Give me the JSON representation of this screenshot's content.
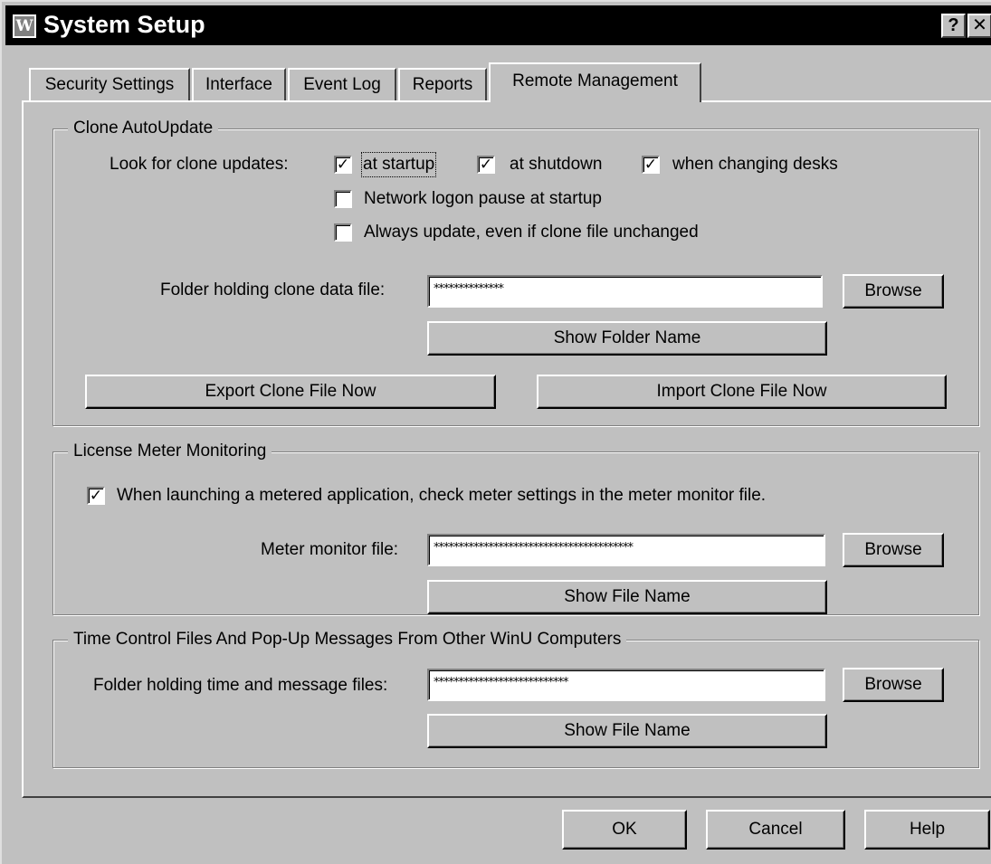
{
  "window": {
    "title": "System Setup",
    "help_glyph": "?",
    "close_glyph": "✕",
    "icon_letter": "W"
  },
  "tabs": [
    {
      "label": "Security Settings",
      "active": false
    },
    {
      "label": "Interface",
      "active": false
    },
    {
      "label": "Event Log",
      "active": false
    },
    {
      "label": "Reports",
      "active": false
    },
    {
      "label": "Remote Management",
      "active": true
    }
  ],
  "clone_autoupdate": {
    "title": "Clone AutoUpdate",
    "look_label": "Look for clone updates:",
    "at_startup": {
      "label": "at startup",
      "checked": true
    },
    "at_shutdown": {
      "label": "at shutdown",
      "checked": true
    },
    "when_changing_desks": {
      "label": "when changing desks",
      "checked": true
    },
    "network_logon_pause": {
      "label": "Network logon pause at startup",
      "checked": false
    },
    "always_update": {
      "label": "Always update, even if clone file unchanged",
      "checked": false
    },
    "folder_label": "Folder holding clone data file:",
    "folder_value": "**************",
    "browse_label": "Browse",
    "show_folder_label": "Show Folder Name",
    "export_label": "Export Clone File Now",
    "import_label": "Import Clone File Now"
  },
  "license_meter": {
    "title": "License Meter Monitoring",
    "check_meter": {
      "label": "When launching a metered application, check meter settings in the meter monitor file.",
      "checked": true
    },
    "file_label": "Meter monitor file:",
    "file_value": "****************************************",
    "browse_label": "Browse",
    "show_file_label": "Show File Name"
  },
  "time_control": {
    "title": "Time Control Files And  Pop-Up Messages From Other WinU Computers",
    "folder_label": "Folder holding time and message files:",
    "folder_value": "***************************",
    "browse_label": "Browse",
    "show_file_label": "Show File Name"
  },
  "footer": {
    "ok_label": "OK",
    "cancel_label": "Cancel",
    "help_label": "Help"
  },
  "check_glyph": "✓"
}
